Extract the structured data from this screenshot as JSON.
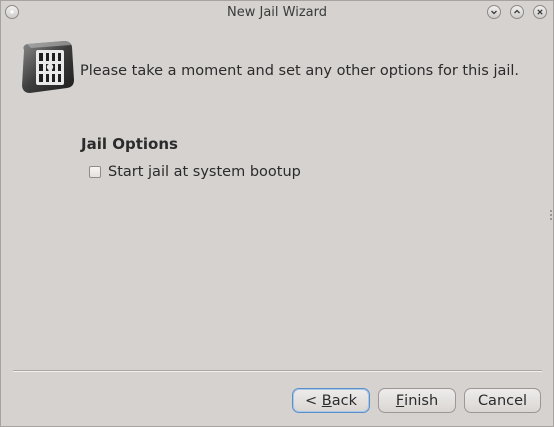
{
  "window": {
    "title": "New Jail Wizard",
    "controls": [
      "menu-icon",
      "minimize-icon",
      "maximize-icon",
      "close-icon"
    ]
  },
  "page": {
    "icon": "jail-icon",
    "intro": "Please take a moment and set any other options for this jail.",
    "section_title": "Jail Options",
    "options": [
      {
        "label": "Start jail at system bootup",
        "checked": false
      }
    ]
  },
  "buttons": {
    "back": {
      "prefix": "< ",
      "mnemonic": "B",
      "rest": "ack"
    },
    "finish": {
      "mnemonic": "F",
      "rest": "inish"
    },
    "cancel": {
      "label": "Cancel"
    }
  },
  "colors": {
    "window_bg": "#d6d2d0",
    "text": "#2b2b2b",
    "focus_border": "#5b8fc7"
  }
}
